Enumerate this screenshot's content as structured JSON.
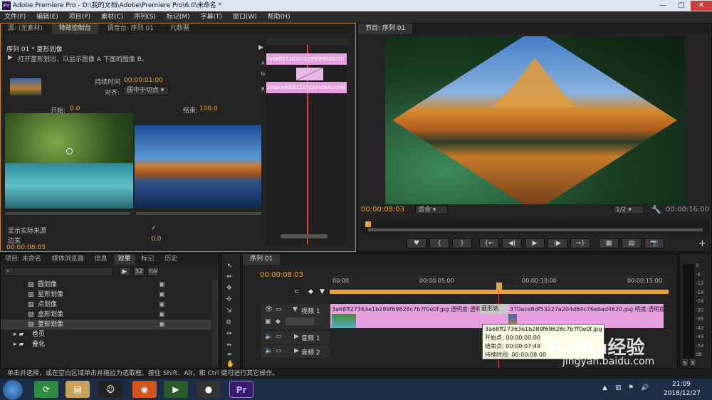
{
  "app": {
    "title": "Adobe Premiere Pro - D:\\我的文档\\Adobe\\Premiere Pro\\6.0\\未命名 *",
    "icon_text": "Pr"
  },
  "menu": [
    "文件(F)",
    "编辑(E)",
    "项目(P)",
    "素材(C)",
    "序列(S)",
    "标记(M)",
    "字幕(T)",
    "窗口(W)",
    "帮助(H)"
  ],
  "source_tabs": [
    "源: (无素材)",
    "特效控制台",
    "调音台: 序列 01",
    "元数据"
  ],
  "effect": {
    "sequence": "序列 01 * 菱形划像",
    "description": "打开菱形划出，以显示图像 A 下面的图像 B。",
    "duration_label": "持续时间",
    "duration_value": "00:00:01:00",
    "align_label": "对齐:",
    "align_value": "居中于切点",
    "start_label": "开始:",
    "start_value": "0.0",
    "end_label": "结束:",
    "end_value": "100.0",
    "show_actual_label": "显示实际来源",
    "border_label": "边宽",
    "border_value": "0.0",
    "timecode": "00:00:08:03",
    "clip_a": "3a68ff27363e1b289f69628c7b",
    "clip_b": "370ace8df53227a204d64c76eb",
    "track_a": "A",
    "track_fx": "fx",
    "track_b": "B"
  },
  "program": {
    "tab": "节目: 序列 01",
    "timecode": "00:00:08:03",
    "fit": "适合",
    "ratio": "1/2",
    "duration": "00:00:16:00"
  },
  "project_tabs": [
    "项目: 未命名",
    "媒体浏览器",
    "信息",
    "效果",
    "标记",
    "历史"
  ],
  "effects_list": [
    {
      "name": "圆划像",
      "type": "item"
    },
    {
      "name": "星形划像",
      "type": "item"
    },
    {
      "name": "点划像",
      "type": "item"
    },
    {
      "name": "盒形划像",
      "type": "item"
    },
    {
      "name": "菱形划像",
      "type": "item"
    },
    {
      "name": "卷页",
      "type": "folder"
    },
    {
      "name": "叠化",
      "type": "folder"
    }
  ],
  "effects_toolbar": {
    "b1": "32",
    "b2": "YUV"
  },
  "timeline": {
    "tab": "序列 01",
    "timecode": "00:00:08:03",
    "ruler": [
      "00:00",
      "00:00:05:00",
      "00:00:10:00",
      "00:00:15:00"
    ],
    "video_track": "视频 1",
    "audio1": "音频 1",
    "audio2": "音频 2",
    "clip1": "3a68ff27363e1b289f69628c7b7f0e0f.jpg  透明度:透明度",
    "transition": "菱形划",
    "clip2": "370ace8df53227a204d64c76ebad4620.jpg  明度:透明度",
    "tooltip": [
      "3a68ff27363e1b289f69628c7b7f0e0f.jpg",
      "开始点: 00:00:00:00",
      "结束点: 00:00:07:49",
      "持续时间: 00:00:08:00"
    ]
  },
  "meter": {
    "labels": [
      "0",
      "-6",
      "-12",
      "-18",
      "-24",
      "-30",
      "-36",
      "-42",
      "-48",
      "-54",
      "dB"
    ],
    "solo": [
      "S",
      "S"
    ]
  },
  "status": "单击并选择，或在空白区域单击并拖拉为选取框。按住 Shift、Alt，和 Ctrl 键可进行其它操作。",
  "taskbar": {
    "time": "21:09",
    "date": "2018/12/27",
    "apps": [
      "browser",
      "explorer",
      "qq",
      "firefox",
      "camtasia",
      "recorder",
      "premiere"
    ]
  },
  "watermark": {
    "text": "Baidu经验",
    "url": "jingyan.baidu.com"
  },
  "colors": {
    "accent": "#e8a33d",
    "clip": "#e8a0e0",
    "playhead": "#e04040",
    "taskbar": "#1d2c45"
  }
}
